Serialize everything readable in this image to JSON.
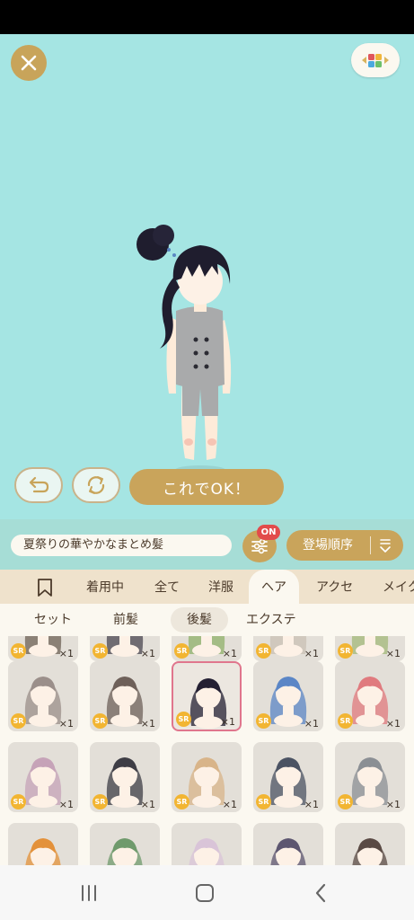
{
  "toolbar": {
    "item_name": "夏祭りの華やかなまとめ髪",
    "filter_badge": "ON",
    "sort_label": "登場順序"
  },
  "actions": {
    "ok_label": "これでOK！"
  },
  "tabs": [
    {
      "label": "着用中"
    },
    {
      "label": "全て"
    },
    {
      "label": "洋服"
    },
    {
      "label": "ヘア",
      "active": true
    },
    {
      "label": "アクセ"
    },
    {
      "label": "メイク"
    }
  ],
  "subtabs": [
    {
      "label": "セット"
    },
    {
      "label": "前髪"
    },
    {
      "label": "後髪",
      "active": true
    },
    {
      "label": "エクステ"
    }
  ],
  "grid": {
    "rarity": "SR",
    "quantity": "×1",
    "rows": [
      [
        {
          "hair": "#6d6256"
        },
        {
          "hair": "#4a4550"
        },
        {
          "hair": "#8fb06a"
        },
        {
          "hair": "#c9c0b4"
        },
        {
          "hair": "#a3b87a"
        }
      ],
      [
        {
          "hair": "#9b8f8a"
        },
        {
          "hair": "#6e6059"
        },
        {
          "hair": "#242033",
          "selected": true
        },
        {
          "hair": "#5b86c6"
        },
        {
          "hair": "#e07a7e"
        }
      ],
      [
        {
          "hair": "#c6a3b8"
        },
        {
          "hair": "#3e3d45"
        },
        {
          "hair": "#d8b489"
        },
        {
          "hair": "#4b5363"
        },
        {
          "hair": "#8b8f94"
        }
      ],
      [
        {
          "hair": "#e3913a"
        },
        {
          "hair": "#6f9a6c"
        },
        {
          "hair": "#d9c4d8"
        },
        {
          "hair": "#5d5670"
        },
        {
          "hair": "#5a4a44"
        }
      ]
    ]
  },
  "colors": {
    "stage_bg": "#a5e5e3",
    "gold": "#c9a45b",
    "tab_bg": "#efe2cc",
    "panel_bg": "#fbf8f0",
    "badge_red": "#e24b4b",
    "rarity_gold": "#f2b532"
  }
}
